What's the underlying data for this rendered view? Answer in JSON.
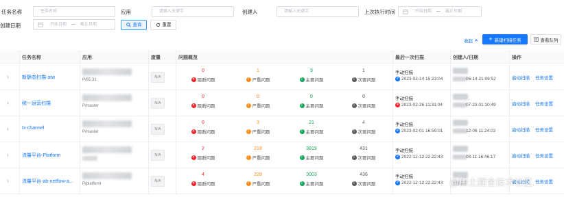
{
  "filters": {
    "task_name_label": "任务名称",
    "task_name_placeholder": "任务名称",
    "app_label": "应用",
    "app_placeholder": "请输入关键字",
    "creator_label": "创建人",
    "creator_placeholder": "请输入关键字",
    "last_exec_label": "上次执行时间",
    "created_label": "创建日期",
    "start_date": "开始日期",
    "end_date": "截止日期",
    "range_sep": "—",
    "query_label": "查询",
    "reset_label": "重置"
  },
  "toolbar": {
    "collapse_label": "收起",
    "new_task_label": "新建扫描任务",
    "view_queue_label": "查看队列"
  },
  "table": {
    "headers": {
      "name": "任务名称",
      "app": "应用",
      "metric": "度量",
      "issues": "问题概览",
      "last_scan": "最后一次扫描",
      "creator": "创建人/日期",
      "ops": "操作"
    },
    "issue_labels": {
      "blocker": "阻断问题",
      "critical": "严重问题",
      "major": "主要问题",
      "minor": "次要问题"
    },
    "metric_tag": "N/A",
    "scan_type": "手动扫描",
    "op_start": "启动扫描",
    "op_settings": "任务设置",
    "rows": [
      {
        "name": "新静态扫描-atw",
        "branch": "P/65.31",
        "blocker": "0",
        "critical": "1",
        "major": "9",
        "minor": "1",
        "scan_time": "2023-03-14 15:23:04",
        "scan_status": "success",
        "creator_time": "06-14 21:09:52"
      },
      {
        "name": "统一运营扫描",
        "branch": "P/master",
        "blocker": "0",
        "critical": "0",
        "major": "0",
        "minor": "0",
        "scan_time": "2023-02-26 11:31:04",
        "scan_status": "error",
        "creator_time": "07-23 01:10:49"
      },
      {
        "name": "tx-channel",
        "branch": "P/master",
        "blocker": "0",
        "critical": "3",
        "major": "21",
        "minor": "4",
        "scan_time": "2023-02-01 16:59:01",
        "scan_status": "success",
        "creator_time": "12-06 11:24:03"
      },
      {
        "name": "流量平台-Platform",
        "branch": "",
        "blocker": "2",
        "critical": "218",
        "major": "3819",
        "minor": "431",
        "scan_time": "2022-12-12 22:22:43",
        "scan_status": "success",
        "creator_time": "08-11 16:46:17"
      },
      {
        "name": "流量平台-ab-netflow-a...",
        "branch": "P/platform",
        "blocker": "4",
        "critical": "228",
        "major": "3003",
        "minor": "436",
        "scan_time": "2022-12-12 22:22:43",
        "scan_status": "success",
        "creator_time": ""
      }
    ]
  },
  "colors": {
    "primary": "#1677ff",
    "blocker": "#f5222d",
    "critical": "#fa8c16",
    "major": "#13a35a",
    "minor": "#595959"
  },
  "watermark": "@稀土掘金技术社区"
}
